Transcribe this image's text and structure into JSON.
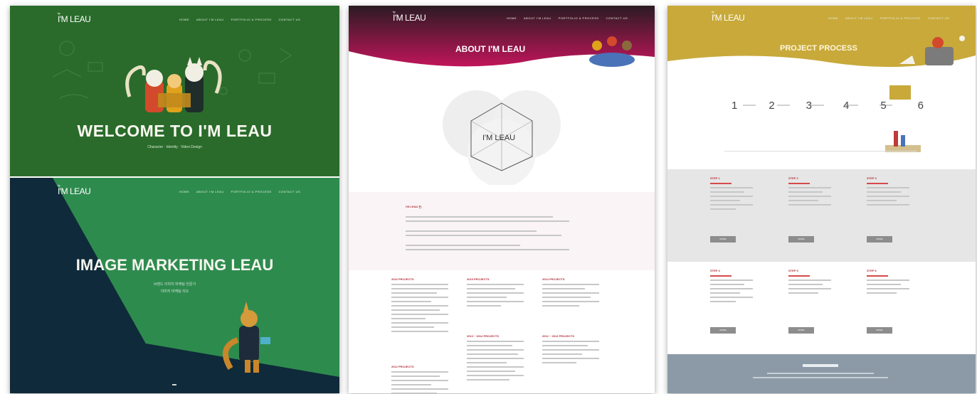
{
  "brand": {
    "logo_text": "I'M LEAU",
    "logo_small": "by"
  },
  "nav": [
    "HOME",
    "ABOUT I'M LEAU",
    "PORTFOLIO & PROCESS",
    "CONTACT US"
  ],
  "panel1": {
    "hero_title": "WELCOME TO I'M LEAU",
    "hero_sub": "Character · Identity · Video Design",
    "slide2_title": "IMAGE MARKETING LEAU",
    "slide2_sub1": "브랜드 이미지 마케팅 전문가",
    "slide2_sub2": "이미지 마케팅 리오"
  },
  "panel2": {
    "section_title": "ABOUT I'M LEAU",
    "diagram_center": "I'M LEAU",
    "intro_head": "I'M LEAU 는,",
    "col_heads": [
      "2016 PROJECTS",
      "2015 PROJECTS",
      "2014 PROJECTS",
      "2013 ~ 2014 PROJECTS",
      "2012 ~ 2013 PROJECTS",
      "2012 PROJECTS"
    ]
  },
  "panel3": {
    "section_title": "PROJECT PROCESS",
    "steps": [
      "1",
      "2",
      "3",
      "4",
      "5",
      "6"
    ],
    "cards": [
      "STEP 1",
      "STEP 2",
      "STEP 3",
      "STEP 4",
      "STEP 5",
      "STEP 6"
    ],
    "more_label": "MORE"
  },
  "colors": {
    "green_dark": "#2a6b2b",
    "green_light": "#2e8b4e",
    "navy": "#0f2a3a",
    "magenta": "#b3144e",
    "gold": "#c8a93a",
    "gray_band": "#e6e6e6",
    "footer_slate": "#8b9aa6"
  }
}
